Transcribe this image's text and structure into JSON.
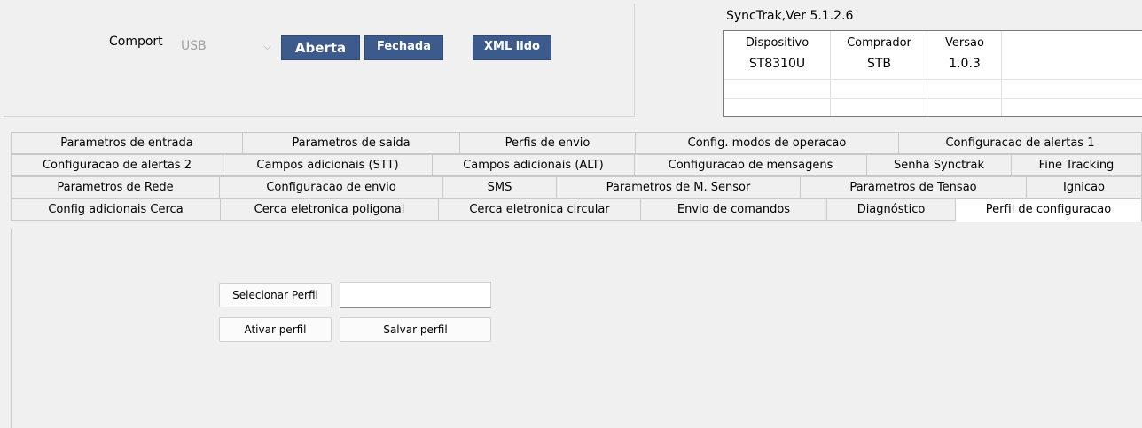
{
  "comport": {
    "label": "Comport",
    "selected": "USB",
    "chevron": "chevron-down-icon"
  },
  "buttons": {
    "aberta": "Aberta",
    "fechada": "Fechada",
    "xml": "XML lido"
  },
  "version_panel": {
    "title": "SyncTrak,Ver 5.1.2.6",
    "headers": [
      "Dispositivo",
      "Comprador",
      "Versao"
    ],
    "row": [
      "ST8310U",
      "STB",
      "1.0.3"
    ]
  },
  "tabs": {
    "row1": [
      "Parametros de entrada",
      "Parametros de saida",
      "Perfis de envio",
      "Config. modos de operacao",
      "Configuracao de alertas 1"
    ],
    "row2": [
      "Configuracao de alertas 2",
      "Campos adicionais (STT)",
      "Campos adicionais (ALT)",
      "Configuracao de mensagens",
      "Senha Synctrak",
      "Fine Tracking"
    ],
    "row3": [
      "Parametros de Rede",
      "Configuracao de envio",
      "SMS",
      "Parametros de M. Sensor",
      "Parametros de Tensao",
      "Ignicao"
    ],
    "row4": [
      "Config adicionais Cerca",
      "Cerca eletronica poligonal",
      "Cerca eletronica circular",
      "Envio de comandos",
      "Diagnóstico",
      "Perfil de configuracao"
    ],
    "active": "Perfil de configuracao"
  },
  "perfil": {
    "selecionar": "Selecionar Perfil",
    "ativar": "Ativar perfil",
    "salvar": "Salvar perfil",
    "path_value": ""
  },
  "colors": {
    "button_blue": "#3c5a8c",
    "background": "#f0f0f0"
  }
}
